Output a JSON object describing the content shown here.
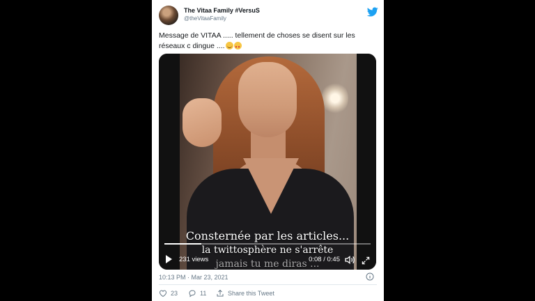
{
  "tweet": {
    "display_name": "The Vitaa Family #VersuS",
    "handle": "@theVitaaFamily",
    "text": "Message de VITAA ..... tellement de choses se disent sur les réseaux c dingue ....",
    "emojis": [
      "smiling-face-icon",
      "heart-eyes-icon"
    ],
    "time": "10:13 PM · Mar 23, 2021",
    "likes": "23",
    "replies": "11",
    "share_label": "Share this Tweet"
  },
  "video": {
    "subtitle_1": "Consternée par les articles...",
    "subtitle_2": "la twittosphère ne s'arrête",
    "subtitle_3": "jamais tu me diras ...",
    "views": "231 views",
    "time": "0:08 / 0:45",
    "progress": 0.18
  },
  "colors": {
    "twitter_blue": "#1da1f2",
    "text": "#14171a",
    "muted": "#657786"
  }
}
